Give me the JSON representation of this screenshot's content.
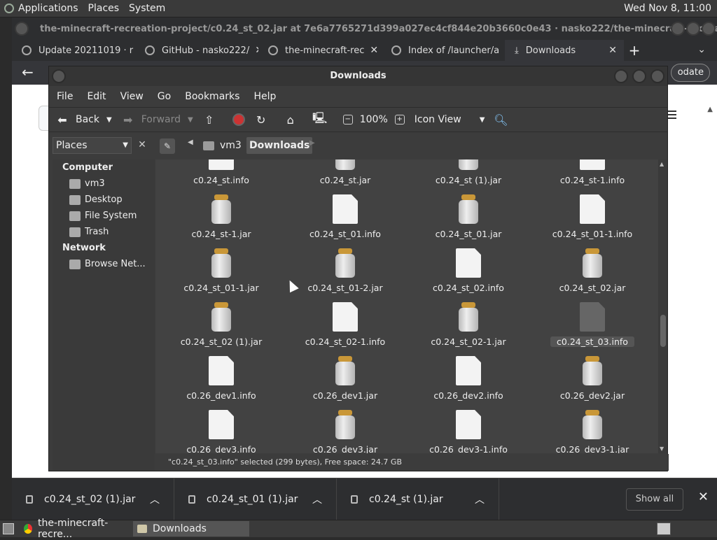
{
  "top_panel": {
    "menus": [
      "Applications",
      "Places",
      "System"
    ],
    "clock": "Wed Nov 8, 11:00"
  },
  "browser": {
    "title": "the-minecraft-recreation-project/c0.24_st_02.jar at 7e6a7765271d399a027ec4cf844e20b3660c0e43 · nasko222/the-minecraft-recreation-proj...",
    "tabs": [
      {
        "label": "Update 20211019 · r"
      },
      {
        "label": "GitHub - nasko222/"
      },
      {
        "label": "the-minecraft-rec"
      },
      {
        "label": "Index of /launcher/a"
      },
      {
        "label": "Downloads"
      }
    ],
    "update_label": "odate"
  },
  "file_manager": {
    "title": "Downloads",
    "menu": [
      "File",
      "Edit",
      "View",
      "Go",
      "Bookmarks",
      "Help"
    ],
    "toolbar": {
      "back": "Back",
      "forward": "Forward",
      "zoom": "100%",
      "view_mode": "Icon View"
    },
    "places_label": "Places",
    "breadcrumbs": [
      "vm3",
      "Downloads"
    ],
    "sidebar": {
      "computer_header": "Computer",
      "computer_items": [
        "vm3",
        "Desktop",
        "File System",
        "Trash"
      ],
      "network_header": "Network",
      "network_items": [
        "Browse Net..."
      ]
    },
    "files": [
      {
        "name": "c0.24_st.info",
        "type": "doc"
      },
      {
        "name": "c0.24_st.jar",
        "type": "jar"
      },
      {
        "name": "c0.24_st (1).jar",
        "type": "jar"
      },
      {
        "name": "c0.24_st-1.info",
        "type": "doc"
      },
      {
        "name": "c0.24_st-1.jar",
        "type": "jar"
      },
      {
        "name": "c0.24_st_01.info",
        "type": "doc"
      },
      {
        "name": "c0.24_st_01.jar",
        "type": "jar"
      },
      {
        "name": "c0.24_st_01-1.info",
        "type": "doc"
      },
      {
        "name": "c0.24_st_01-1.jar",
        "type": "jar"
      },
      {
        "name": "c0.24_st_01-2.jar",
        "type": "jar"
      },
      {
        "name": "c0.24_st_02.info",
        "type": "doc"
      },
      {
        "name": "c0.24_st_02.jar",
        "type": "jar"
      },
      {
        "name": "c0.24_st_02 (1).jar",
        "type": "jar"
      },
      {
        "name": "c0.24_st_02-1.info",
        "type": "doc"
      },
      {
        "name": "c0.24_st_02-1.jar",
        "type": "jar"
      },
      {
        "name": "c0.24_st_03.info",
        "type": "doc",
        "selected": true
      },
      {
        "name": "c0.26_dev1.info",
        "type": "doc"
      },
      {
        "name": "c0.26_dev1.jar",
        "type": "jar"
      },
      {
        "name": "c0.26_dev2.info",
        "type": "doc"
      },
      {
        "name": "c0.26_dev2.jar",
        "type": "jar"
      },
      {
        "name": "c0.26_dev3.info",
        "type": "doc"
      },
      {
        "name": "c0.26_dev3.jar",
        "type": "jar"
      },
      {
        "name": "c0.26_dev3-1.info",
        "type": "doc"
      },
      {
        "name": "c0.26_dev3-1.jar",
        "type": "jar"
      }
    ],
    "status": "\"c0.24_st_03.info\" selected (299 bytes), Free space: 24.7 GB"
  },
  "downloads_shelf": {
    "items": [
      "c0.24_st_02 (1).jar",
      "c0.24_st_01 (1).jar",
      "c0.24_st (1).jar"
    ],
    "show_all": "Show all"
  },
  "taskbar": {
    "items": [
      "the-minecraft-recre...",
      "Downloads"
    ]
  }
}
